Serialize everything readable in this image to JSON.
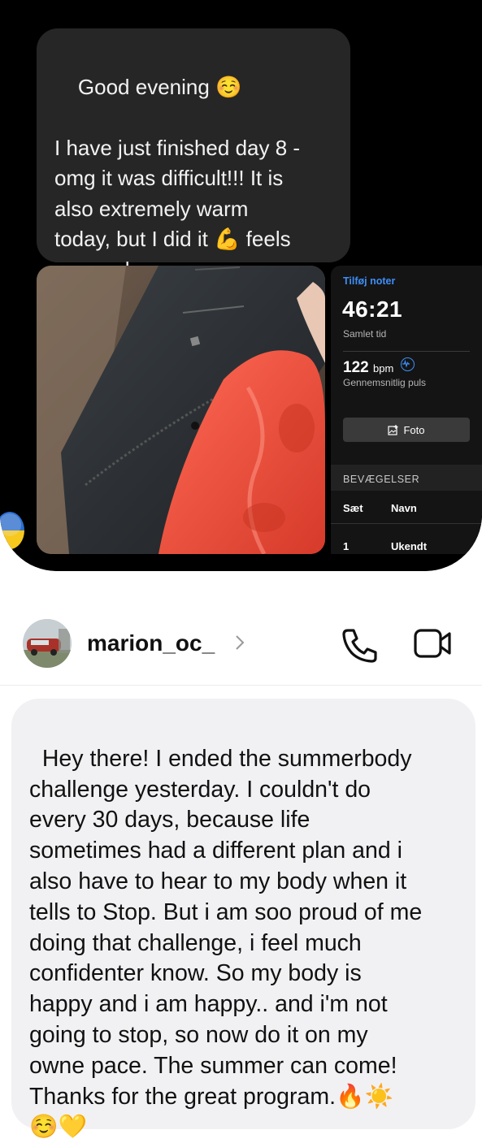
{
  "top_screenshot": {
    "message_text": "Good evening ☺️\n\nI have just finished day 8 -\nomg it was difficult!!! It is\nalso extremely warm\ntoday, but I did it 💪 feels\nso good",
    "workout": {
      "add_notes_label": "Tilføj noter",
      "total_time": "46:21",
      "total_time_label": "Samlet tid",
      "avg_hr_value": "122",
      "avg_hr_unit": "bpm",
      "avg_hr_label": "Gennemsnitlig puls",
      "photo_button_label": "Foto",
      "movements_header": "BEVÆGELSER",
      "columns": [
        "Sæt",
        "Navn"
      ],
      "rows": [
        {
          "set": "1",
          "name": "Ukendt"
        }
      ]
    },
    "accent_color": "#3e8ef7"
  },
  "header": {
    "username": "marion_oc_",
    "icons": [
      "chevron-right-icon",
      "phone-icon",
      "video-camera-icon"
    ]
  },
  "message": {
    "text": "Hey there! I ended the summerbody\nchallenge yesterday. I couldn't do\nevery 30 days, because life\nsometimes had a different plan and i\nalso have to hear to my body when it\ntells to Stop. But i am soo proud of me\ndoing that challenge, i feel much\nconfidenter know. So my body is\nhappy and i am happy.. and i'm not\ngoing to stop, so now do it on my\nowne pace. The summer can come!\nThanks for the great program.🔥☀️\n☺️💛"
  }
}
